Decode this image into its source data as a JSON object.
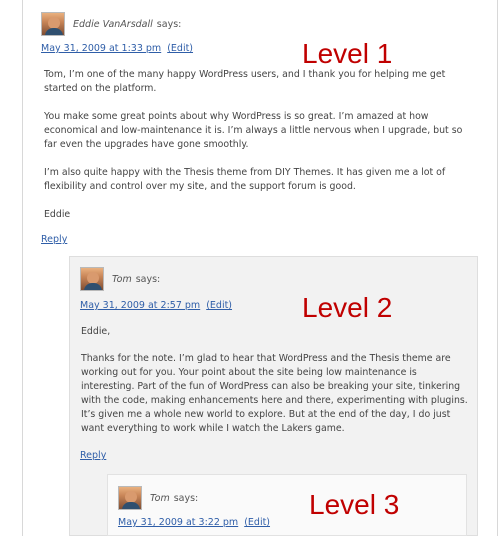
{
  "level_labels": [
    "Level 1",
    "Level 2",
    "Level 3"
  ],
  "comment1": {
    "author": "Eddie VanArsdall",
    "says": "says:",
    "date": "May 31, 2009 at 1:33 pm",
    "edit": "(Edit)",
    "paragraphs": [
      "Tom, I’m one of the many happy WordPress users, and I thank you for helping me get started on the platform.",
      "You make some great points about why WordPress is so great. I’m amazed at how economical and low-maintenance it is. I’m always a little nervous when I upgrade, but so far even the upgrades have gone smoothly.",
      "I’m also quite happy with the Thesis theme from DIY Themes. It has given me a lot of flexibility and control over my site, and the support forum is good.",
      "Eddie"
    ],
    "reply": "Reply"
  },
  "comment2": {
    "author": "Tom",
    "says": "says:",
    "date": "May 31, 2009 at 2:57 pm",
    "edit": "(Edit)",
    "paragraphs": [
      "Eddie,",
      "Thanks for the note. I’m glad to hear that WordPress and the Thesis theme are working out for you. Your point about the site being low maintenance is interesting. Part of the fun of WordPress can also be breaking your site, tinkering with the code, making enhancements here and there, experimenting with plugins. It’s given me a whole new world to explore. But at the end of the day, I do just want everything to work while I watch the Lakers game."
    ],
    "reply": "Reply"
  },
  "comment3": {
    "author": "Tom",
    "says": "says:",
    "date": "May 31, 2009 at 3:22 pm",
    "edit": "(Edit)"
  }
}
